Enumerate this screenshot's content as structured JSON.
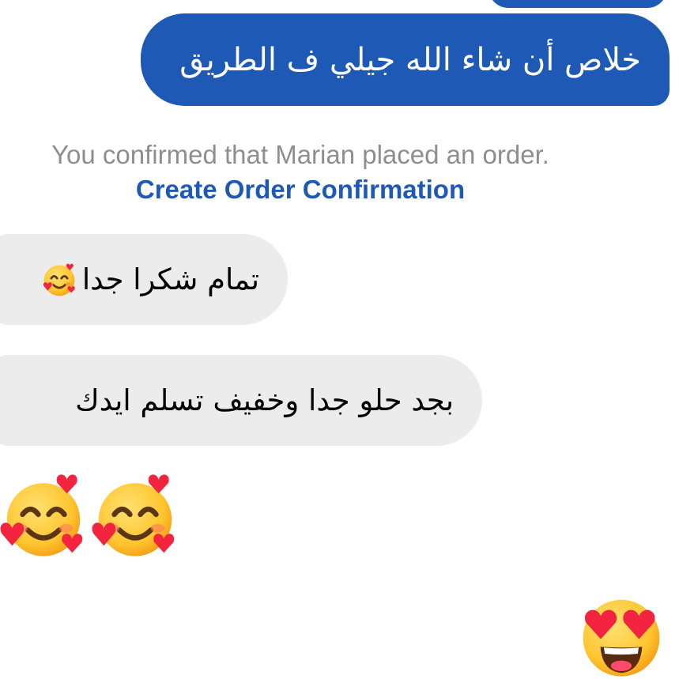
{
  "conversation": {
    "outgoing_message": "خلاص أن شاء الله جيلي ف الطريق",
    "system_note": {
      "text": "You confirmed that Marian placed an order.",
      "link_label": "Create Order Confirmation"
    },
    "incoming_messages": [
      {
        "text": "تمام شكرا جدا",
        "emoji": "smiling-face-with-hearts-icon"
      },
      {
        "text": "بجد حلو جدا وخفيف تسلم ايدك"
      }
    ],
    "emoji_messages": [
      {
        "emojis": [
          "smiling-face-with-hearts-icon",
          "smiling-face-with-hearts-icon"
        ],
        "side": "incoming"
      },
      {
        "emojis": [
          "heart-eyes-face-icon"
        ],
        "side": "outgoing"
      }
    ]
  },
  "colors": {
    "outgoing_bubble": "#1d59b5",
    "incoming_bubble": "#ececec",
    "link": "#1d59b5",
    "system_text": "#8e8e8e"
  }
}
